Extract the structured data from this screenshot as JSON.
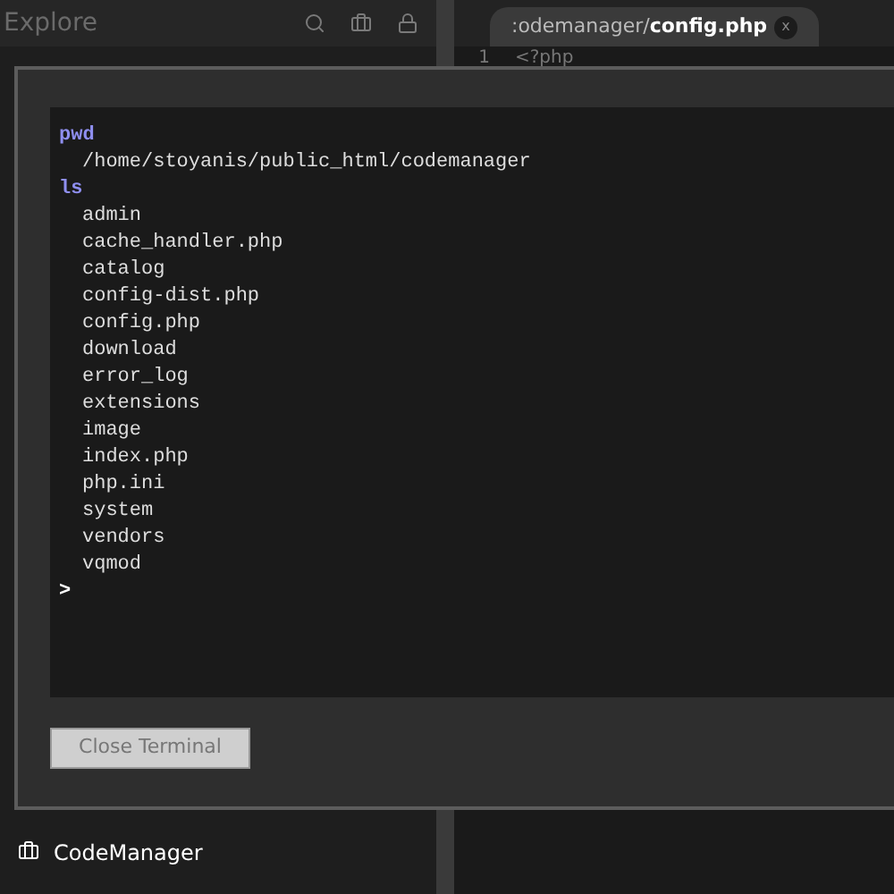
{
  "sidebar": {
    "title": "Explore",
    "project": "CodeManager"
  },
  "editor": {
    "tab": {
      "path": ":odemanager/",
      "file": "config.php",
      "close": "x"
    },
    "lines": [
      {
        "number": "1",
        "code": "<?php"
      }
    ]
  },
  "terminal": {
    "lines": [
      {
        "kind": "command",
        "text": "pwd"
      },
      {
        "kind": "output",
        "text": "/home/stoyanis/public_html/codemanager"
      },
      {
        "kind": "command",
        "text": "ls"
      },
      {
        "kind": "output",
        "text": "admin"
      },
      {
        "kind": "output",
        "text": "cache_handler.php"
      },
      {
        "kind": "output",
        "text": "catalog"
      },
      {
        "kind": "output",
        "text": "config-dist.php"
      },
      {
        "kind": "output",
        "text": "config.php"
      },
      {
        "kind": "output",
        "text": "download"
      },
      {
        "kind": "output",
        "text": "error_log"
      },
      {
        "kind": "output",
        "text": "extensions"
      },
      {
        "kind": "output",
        "text": "image"
      },
      {
        "kind": "output",
        "text": "index.php"
      },
      {
        "kind": "output",
        "text": "php.ini"
      },
      {
        "kind": "output",
        "text": "system"
      },
      {
        "kind": "output",
        "text": "vendors"
      },
      {
        "kind": "output",
        "text": "vqmod"
      }
    ],
    "prompt": ">",
    "close_button": "Close Terminal"
  }
}
